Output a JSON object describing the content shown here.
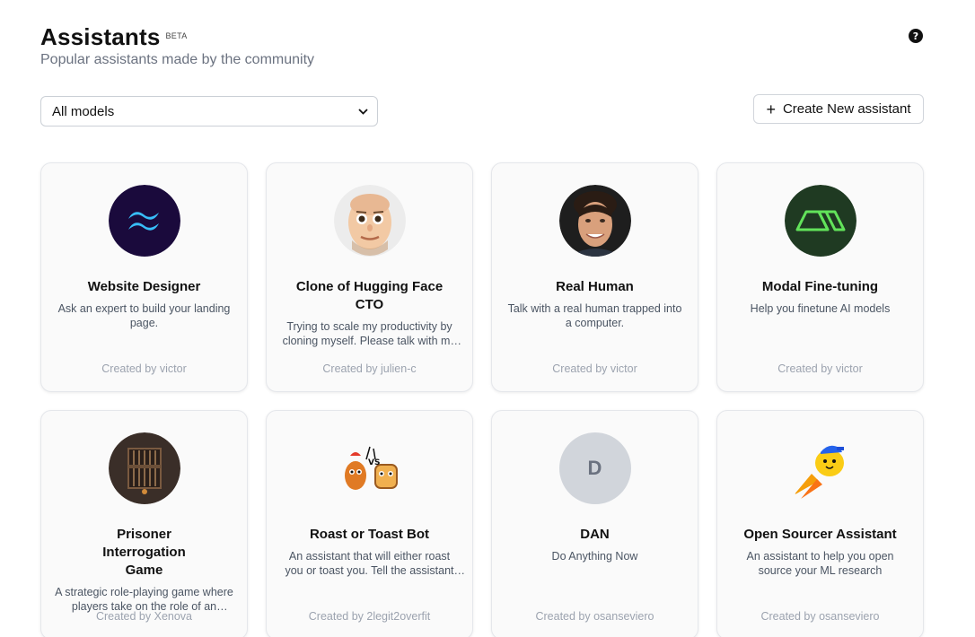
{
  "header": {
    "title": "Assistants",
    "badge": "BETA",
    "subtitle": "Popular assistants made by the community"
  },
  "help_icon": "?",
  "filter": {
    "selected": "All models"
  },
  "create_button": {
    "icon": "+",
    "label": "Create New assistant"
  },
  "assistants": [
    {
      "name": "Website Designer",
      "description": "Ask an expert to build your landing page.",
      "creator": "Created by victor",
      "avatar_icon": "tailwind-logo-icon"
    },
    {
      "name": "Clone of Hugging Face CTO",
      "description": "Trying to scale my productivity by cloning myself. Please talk with me about stuff",
      "creator": "Created by julien-c",
      "avatar_icon": "cartoon-face-avatar"
    },
    {
      "name": "Real Human",
      "description": "Talk with a real human trapped into a computer.",
      "creator": "Created by victor",
      "avatar_icon": "human-photo-avatar"
    },
    {
      "name": "Modal Fine-tuning",
      "description": "Help you finetune AI models",
      "creator": "Created by victor",
      "avatar_icon": "modal-logo-icon"
    },
    {
      "name": "Prisoner Interrogation Game",
      "description": "A strategic role-playing game where players take on the role of an interrogator",
      "creator": "Created by Xenova",
      "avatar_icon": "prison-cell-avatar"
    },
    {
      "name": "Roast or Toast Bot",
      "description": "An assistant that will either roast you or toast you. Tell the assistant about yourself",
      "creator": "Created by 2legit2overfit",
      "avatar_icon": "toast-vs-avatar"
    },
    {
      "name": "DAN",
      "description": "Do Anything Now",
      "creator": "Created by osanseviero",
      "avatar_letter": "D"
    },
    {
      "name": "Open Sourcer Assistant",
      "description": "An assistant to help you open source your ML research",
      "creator": "Created by osanseviero",
      "avatar_icon": "rocket-duck-avatar"
    }
  ]
}
